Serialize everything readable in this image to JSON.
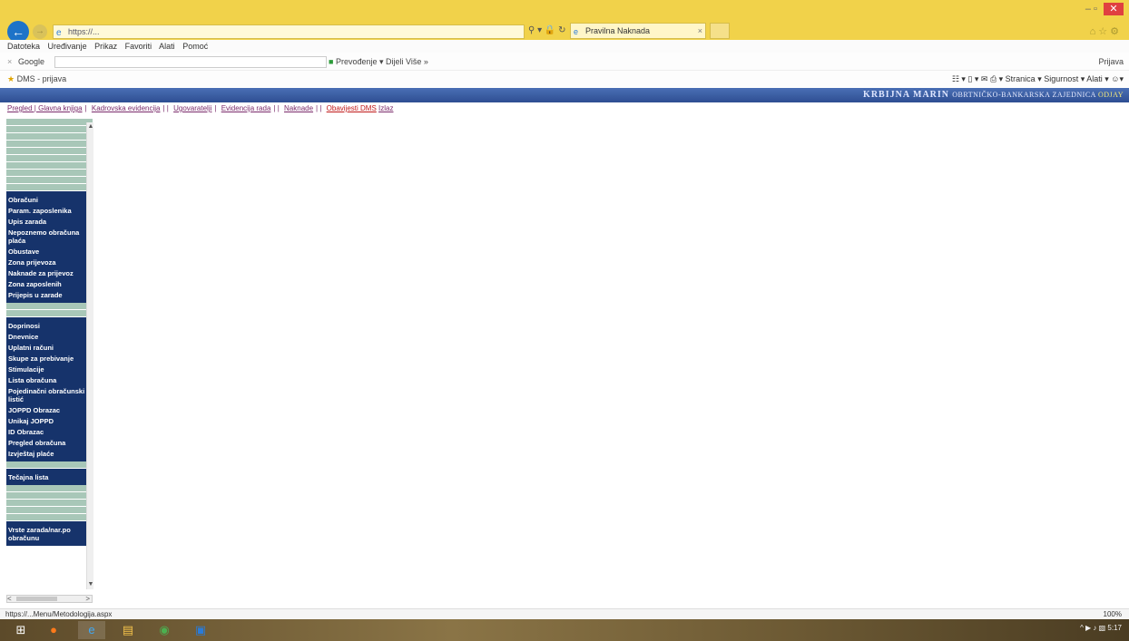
{
  "browser": {
    "address_url": "https://...",
    "tab_title": "Pravilna Naknada",
    "menu": [
      "Datoteka",
      "Uređivanje",
      "Prikaz",
      "Favoriti",
      "Alati",
      "Pomoć"
    ],
    "google_label": "Google",
    "google_tools": "Prevođenje ▾  Dijeli  Više »",
    "google_signin": "Prijava",
    "favorite_item": "DMS - prijava",
    "fav_tools": "Stranica ▾  Sigurnost ▾  Alati ▾",
    "win_min": "–",
    "win_max": "▫",
    "win_close": "✕"
  },
  "app_header": {
    "user": "KRBIJNA MARIN",
    "org_prefix": "OBRTNIČKO-BANKARSKA ZAJEDNICA",
    "org_name": "ODJAY"
  },
  "app_nav": [
    {
      "label": "Pregled | Glavna knjiga",
      "red": false
    },
    {
      "label": "Kadrovska evidencija",
      "red": false
    },
    {
      "label": "Ugovaratelji",
      "red": false
    },
    {
      "label": "Evidencija rada",
      "red": false
    },
    {
      "label": "Naknade",
      "red": false
    },
    {
      "label": "Obavijesti DMS",
      "red": true
    },
    {
      "label": "Izlaz",
      "red": false
    }
  ],
  "sidebar": {
    "group1": [
      "Obračuni",
      "Param. zaposlenika",
      "Upis zarada",
      "Nepoznemo obračuna plaća",
      "Obustave",
      "Zona prijevoza",
      "Naknade za prijevoz",
      "Zona zaposlenih",
      "Prijepis u zarade"
    ],
    "group2": [
      "Doprinosi",
      "Dnevnice",
      "Uplatni računi",
      "Skupe za prebivanje",
      "Stimulacije",
      "Lista obračuna",
      "Pojedinačni obračunski listić",
      "JOPPD Obrazac",
      "Unikaj JOPPD",
      "ID Obrazac",
      "Pregled obračuna",
      "Izvještaj plaće"
    ],
    "group3": [
      "Tečajna lista"
    ],
    "group4": [
      "Vrste zarada/nar.po obračunu"
    ]
  },
  "status_url": "https://...Menu/Metodologija.aspx",
  "zoom": "100%",
  "tray": "5:17"
}
